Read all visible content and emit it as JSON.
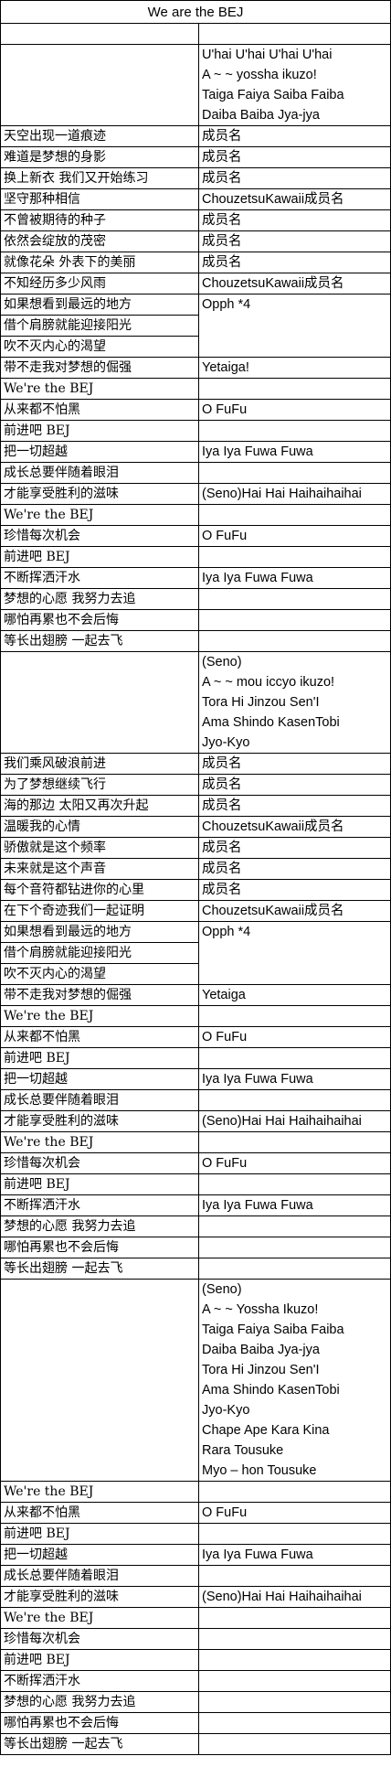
{
  "title": "We are the BEJ",
  "sections": [
    {
      "type": "spacer"
    },
    {
      "type": "block",
      "left": "",
      "right": [
        "U'hai U'hai U'hai U'hai",
        "A ~ ~ yossha ikuzo!",
        "Taiga Faiya Saiba Faiba",
        "Daiba Baiba Jya-jya"
      ]
    },
    {
      "type": "pair",
      "left": "天空出现一道痕迹",
      "right": "成员名"
    },
    {
      "type": "pair",
      "left": "难道是梦想的身影",
      "right": "成员名"
    },
    {
      "type": "pair",
      "left": "换上新衣 我们又开始练习",
      "right": "成员名"
    },
    {
      "type": "pair",
      "left": "坚守那种相信",
      "right": "ChouzetsuKawaii成员名"
    },
    {
      "type": "pair",
      "left": "不曾被期待的种子",
      "right": "成员名"
    },
    {
      "type": "pair",
      "left": "依然会绽放的茂密",
      "right": "成员名"
    },
    {
      "type": "pair",
      "left": "就像花朵 外表下的美丽",
      "right": "成员名"
    },
    {
      "type": "pair",
      "left": "不知经历多少风雨",
      "right": "ChouzetsuKawaii成员名"
    },
    {
      "type": "merged",
      "left": [
        "如果想看到最远的地方",
        "借个肩膀就能迎接阳光",
        "吹不灭内心的渴望"
      ],
      "right": "Opph *4"
    },
    {
      "type": "pair",
      "left": "带不走我对梦想的倔强",
      "right": "Yetaiga!"
    },
    {
      "type": "pair",
      "left": "We're the BEJ",
      "right": ""
    },
    {
      "type": "pair",
      "left": "从来都不怕黑",
      "right": "O FuFu"
    },
    {
      "type": "pair",
      "left": "前进吧 BEJ",
      "right": ""
    },
    {
      "type": "pair",
      "left": "把一切超越",
      "right": "Iya Iya Fuwa Fuwa"
    },
    {
      "type": "pair",
      "left": "成长总要伴随着眼泪",
      "right": ""
    },
    {
      "type": "pair",
      "left": "才能享受胜利的滋味",
      "right": "(Seno)Hai Hai Haihaihaihai"
    },
    {
      "type": "pair",
      "left": "We're the BEJ",
      "right": ""
    },
    {
      "type": "pair",
      "left": "珍惜每次机会",
      "right": "O FuFu"
    },
    {
      "type": "pair",
      "left": "前进吧 BEJ",
      "right": ""
    },
    {
      "type": "pair",
      "left": "不断挥洒汗水",
      "right": "Iya Iya Fuwa Fuwa"
    },
    {
      "type": "pair",
      "left": "梦想的心愿 我努力去追",
      "right": ""
    },
    {
      "type": "pair",
      "left": "哪怕再累也不会后悔",
      "right": ""
    },
    {
      "type": "pair",
      "left": "等长出翅膀 一起去飞",
      "right": ""
    },
    {
      "type": "block",
      "left": "",
      "right": [
        "(Seno)",
        "A ~ ~ mou iccyo ikuzo!",
        "Tora Hi Jinzou Sen'I",
        "Ama Shindo KasenTobi",
        "Jyo-Kyo"
      ]
    },
    {
      "type": "pair",
      "left": "我们乘风破浪前进",
      "right": "成员名"
    },
    {
      "type": "pair",
      "left": "为了梦想继续飞行",
      "right": "成员名"
    },
    {
      "type": "pair",
      "left": "海的那边 太阳又再次升起",
      "right": "成员名"
    },
    {
      "type": "pair",
      "left": "温暖我的心情",
      "right": "ChouzetsuKawaii成员名"
    },
    {
      "type": "pair",
      "left": "骄傲就是这个频率",
      "right": "成员名"
    },
    {
      "type": "pair",
      "left": "未来就是这个声音",
      "right": "成员名"
    },
    {
      "type": "pair",
      "left": "每个音符都钻进你的心里",
      "right": "成员名"
    },
    {
      "type": "pair",
      "left": "在下个奇迹我们一起证明",
      "right": "ChouzetsuKawaii成员名"
    },
    {
      "type": "merged",
      "left": [
        "如果想看到最远的地方",
        "借个肩膀就能迎接阳光",
        "吹不灭内心的渴望"
      ],
      "right": "Opph *4"
    },
    {
      "type": "pair",
      "left": "带不走我对梦想的倔强",
      "right": "Yetaiga"
    },
    {
      "type": "pair",
      "left": "We're the BEJ",
      "right": ""
    },
    {
      "type": "pair",
      "left": "从来都不怕黑",
      "right": "O FuFu"
    },
    {
      "type": "pair",
      "left": "前进吧 BEJ",
      "right": ""
    },
    {
      "type": "pair",
      "left": "把一切超越",
      "right": "Iya Iya Fuwa Fuwa"
    },
    {
      "type": "pair",
      "left": "成长总要伴随着眼泪",
      "right": ""
    },
    {
      "type": "pair",
      "left": "才能享受胜利的滋味",
      "right": "(Seno)Hai Hai Haihaihaihai"
    },
    {
      "type": "pair",
      "left": "We're the BEJ",
      "right": ""
    },
    {
      "type": "pair",
      "left": "珍惜每次机会",
      "right": "O FuFu"
    },
    {
      "type": "pair",
      "left": "前进吧 BEJ",
      "right": ""
    },
    {
      "type": "pair",
      "left": "不断挥洒汗水",
      "right": "Iya Iya Fuwa Fuwa"
    },
    {
      "type": "pair",
      "left": "梦想的心愿 我努力去追",
      "right": ""
    },
    {
      "type": "pair",
      "left": "哪怕再累也不会后悔",
      "right": ""
    },
    {
      "type": "pair",
      "left": "等长出翅膀 一起去飞",
      "right": ""
    },
    {
      "type": "block",
      "left": "",
      "right": [
        "(Seno)",
        "A ~ ~ Yossha Ikuzo!",
        "Taiga Faiya Saiba Faiba",
        "Daiba Baiba Jya-jya",
        "Tora Hi Jinzou Sen'I",
        "Ama Shindo KasenTobi",
        "Jyo-Kyo",
        "Chape Ape Kara Kina",
        "Rara Tousuke",
        "Myo – hon Tousuke"
      ]
    },
    {
      "type": "pair",
      "left": "We're the BEJ",
      "right": ""
    },
    {
      "type": "pair",
      "left": "从来都不怕黑",
      "right": "O FuFu"
    },
    {
      "type": "pair",
      "left": "前进吧 BEJ",
      "right": ""
    },
    {
      "type": "pair",
      "left": "把一切超越",
      "right": "Iya Iya Fuwa Fuwa"
    },
    {
      "type": "pair",
      "left": "成长总要伴随着眼泪",
      "right": ""
    },
    {
      "type": "pair",
      "left": "才能享受胜利的滋味",
      "right": "(Seno)Hai Hai Haihaihaihai"
    },
    {
      "type": "pair",
      "left": "We're the BEJ",
      "right": ""
    },
    {
      "type": "pair",
      "left": "珍惜每次机会",
      "right": ""
    },
    {
      "type": "pair",
      "left": "前进吧 BEJ",
      "right": ""
    },
    {
      "type": "pair",
      "left": "不断挥洒汗水",
      "right": ""
    },
    {
      "type": "pair",
      "left": "梦想的心愿 我努力去追",
      "right": ""
    },
    {
      "type": "pair",
      "left": "哪怕再累也不会后悔",
      "right": ""
    },
    {
      "type": "pair",
      "left": "等长出翅膀 一起去飞",
      "right": ""
    }
  ]
}
